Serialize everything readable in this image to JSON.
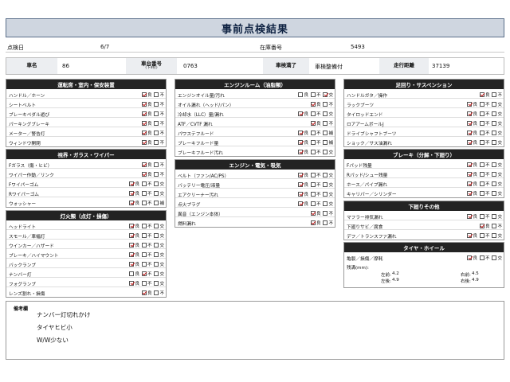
{
  "title": "事前点検結果",
  "info": {
    "date_label": "点検日",
    "date_value": "6/7",
    "stock_label": "在庫番号",
    "stock_value": "5493"
  },
  "car": {
    "name_label": "車名",
    "name_value": "86",
    "chassis_label": "車台番号",
    "chassis_sub": "(下4桁)",
    "chassis_value": "0763",
    "inspection_label": "車検満了",
    "inspection_value": "車検整備付",
    "mileage_label": "走行距離",
    "mileage_value": "37139"
  },
  "option_labels": {
    "good": "良",
    "bad": "不",
    "replace": "交",
    "supply": "補"
  },
  "panels": {
    "driving": {
      "title": "運転席・室内・保安装置",
      "rows": [
        {
          "name": "ハンドル／ホーン",
          "opts": [
            "good",
            "bad"
          ],
          "checked": "good"
        },
        {
          "name": "シートベルト",
          "opts": [
            "good",
            "bad"
          ],
          "checked": "good"
        },
        {
          "name": "ブレーキペダル遊び",
          "opts": [
            "good",
            "bad"
          ],
          "checked": "good"
        },
        {
          "name": "パーキングブレーキ",
          "opts": [
            "good",
            "bad"
          ],
          "checked": "good"
        },
        {
          "name": "メーター／警告灯",
          "opts": [
            "good",
            "bad"
          ],
          "checked": "good"
        },
        {
          "name": "ウィンドウ開閉",
          "opts": [
            "good",
            "bad"
          ],
          "checked": "good"
        }
      ]
    },
    "vision": {
      "title": "視界・ガラス・ワイパー",
      "rows": [
        {
          "name": "Fガラス（傷・ヒビ）",
          "opts": [
            "good",
            "bad"
          ],
          "checked": "good"
        },
        {
          "name": "ワイパー作動／リンク",
          "opts": [
            "good",
            "bad"
          ],
          "checked": "good"
        },
        {
          "name": "Fワイパーゴム",
          "opts": [
            "good",
            "bad",
            "replace"
          ],
          "checked": "good"
        },
        {
          "name": "Rワイパーゴム",
          "opts": [
            "good",
            "bad",
            "replace"
          ],
          "checked": "good"
        },
        {
          "name": "ウォッシャー",
          "opts": [
            "good",
            "bad",
            "supply"
          ],
          "checked": "good"
        }
      ]
    },
    "lights": {
      "title": "灯火類（点灯・損傷）",
      "rows": [
        {
          "name": "ヘッドライト",
          "opts": [
            "good",
            "bad",
            "replace"
          ],
          "checked": "good"
        },
        {
          "name": "スモール／車幅灯",
          "opts": [
            "good",
            "bad",
            "replace"
          ],
          "checked": "good"
        },
        {
          "name": "ウインカー／ハザード",
          "opts": [
            "good",
            "bad",
            "replace"
          ],
          "checked": "good"
        },
        {
          "name": "ブレーキ／ハイマウント",
          "opts": [
            "good",
            "bad",
            "replace"
          ],
          "checked": "good"
        },
        {
          "name": "バックランプ",
          "opts": [
            "good",
            "bad",
            "replace"
          ],
          "checked": "good"
        },
        {
          "name": "ナンバー灯",
          "opts": [
            "good",
            "bad",
            "replace"
          ],
          "checked": "bad"
        },
        {
          "name": "フォグランプ",
          "opts": [
            "good",
            "bad",
            "replace"
          ],
          "checked": "good"
        },
        {
          "name": "レンズ割れ・損傷",
          "opts": [
            "good",
            "bad"
          ],
          "checked": "good"
        }
      ]
    },
    "engine": {
      "title": "エンジンルーム（油脂類）",
      "rows": [
        {
          "name": "エンジンオイル量/汚れ",
          "opts": [
            "good",
            "bad",
            "replace"
          ],
          "checked": "replace"
        },
        {
          "name": "オイル漏れ（ヘッド/パン）",
          "opts": [
            "good",
            "bad"
          ],
          "checked": "good"
        },
        {
          "name": "冷却水（LLC）量/漏れ",
          "opts": [
            "good",
            "bad",
            "replace"
          ],
          "checked": "good"
        },
        {
          "name": "ATF／CVTF 漏れ",
          "opts": [
            "good",
            "bad"
          ],
          "checked": "good"
        },
        {
          "name": "パワステフルード",
          "opts": [
            "good",
            "bad",
            "supply"
          ],
          "checked": "good"
        },
        {
          "name": "ブレーキフルード量",
          "opts": [
            "good",
            "bad",
            "supply"
          ],
          "checked": "good"
        },
        {
          "name": "ブレーキフルード汚れ",
          "opts": [
            "good",
            "bad",
            "replace"
          ],
          "checked": "good"
        }
      ]
    },
    "electric": {
      "title": "エンジン・電気・吸気",
      "rows": [
        {
          "name": "ベルト（ファン/AC/PS）",
          "opts": [
            "good",
            "bad",
            "replace"
          ],
          "checked": "good"
        },
        {
          "name": "バッテリー電圧/液量",
          "opts": [
            "good",
            "bad",
            "replace"
          ],
          "checked": "good"
        },
        {
          "name": "エアクリーナー汚れ",
          "opts": [
            "good",
            "bad",
            "replace"
          ],
          "checked": "good"
        },
        {
          "name": "点火プラグ",
          "opts": [
            "good",
            "bad",
            "replace"
          ],
          "checked": "good"
        },
        {
          "name": "異音（エンジン本体）",
          "opts": [
            "good",
            "bad"
          ],
          "checked": "good"
        },
        {
          "name": "燃料漏れ",
          "opts": [
            "good",
            "bad"
          ],
          "checked": "good"
        }
      ]
    },
    "suspension": {
      "title": "足回り・サスペンション",
      "rows": [
        {
          "name": "ハンドルガタ／操作",
          "opts": [
            "good",
            "bad"
          ],
          "checked": "good"
        },
        {
          "name": "ラックブーツ",
          "opts": [
            "good",
            "bad",
            "replace"
          ],
          "checked": "good"
        },
        {
          "name": "タイロッドエンド",
          "opts": [
            "good",
            "bad",
            "replace"
          ],
          "checked": "good"
        },
        {
          "name": "ロアアームボールJ",
          "opts": [
            "good",
            "bad",
            "replace"
          ],
          "checked": "good"
        },
        {
          "name": "ドライブシャフトブーツ",
          "opts": [
            "good",
            "bad",
            "replace"
          ],
          "checked": "good"
        },
        {
          "name": "ショック／サス油漏れ",
          "opts": [
            "good",
            "bad",
            "replace"
          ],
          "checked": "good"
        }
      ]
    },
    "brake": {
      "title": "ブレーキ（分解・下廻り）",
      "rows": [
        {
          "name": "Fパッド残量",
          "opts": [
            "good",
            "bad",
            "replace"
          ],
          "checked": "good"
        },
        {
          "name": "Rパッド/シュー残量",
          "opts": [
            "good",
            "bad",
            "replace"
          ],
          "checked": "good"
        },
        {
          "name": "ホース／パイプ漏れ",
          "opts": [
            "good",
            "bad",
            "replace"
          ],
          "checked": "good"
        },
        {
          "name": "キャリパー／シリンダー",
          "opts": [
            "good",
            "bad",
            "replace"
          ],
          "checked": "good"
        }
      ]
    },
    "under": {
      "title": "下廻りその他",
      "rows": [
        {
          "name": "マフラー排気漏れ",
          "opts": [
            "good",
            "bad",
            "replace"
          ],
          "checked": "good"
        },
        {
          "name": "下廻りサビ／腐食",
          "opts": [
            "good",
            "bad"
          ],
          "checked": "good"
        },
        {
          "name": "デフ／トランスファ漏れ",
          "opts": [
            "good",
            "bad",
            "replace"
          ],
          "checked": "good"
        }
      ]
    },
    "tire": {
      "title": "タイヤ・ホイール",
      "rows": [
        {
          "name": "亀裂／損傷／摩耗",
          "opts": [
            "good",
            "bad",
            "replace"
          ],
          "checked": "good"
        }
      ],
      "remain_label": "残溝(mm):",
      "fl_label": "左前:",
      "fl_value": "4.2",
      "fr_label": "右前:",
      "fr_value": "4.5",
      "rl_label": "左後:",
      "rl_value": "4.9",
      "rr_label": "右後:",
      "rr_value": "4.9"
    }
  },
  "remarks": {
    "title": "備考欄",
    "lines": [
      "ナンバー灯切れかけ",
      "タイヤヒビ小",
      "W/W少ない"
    ]
  }
}
